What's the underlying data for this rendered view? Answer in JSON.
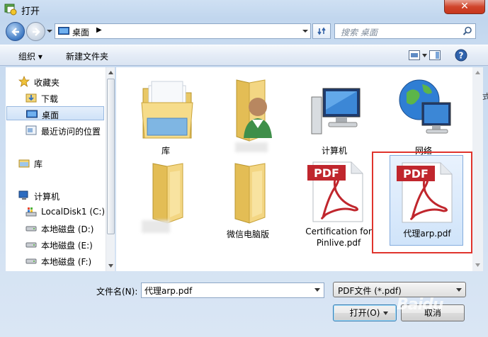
{
  "window": {
    "title": "打开",
    "close_glyph": "✕"
  },
  "address": {
    "path": "桌面",
    "separator": "▶"
  },
  "search": {
    "placeholder": "搜索 桌面"
  },
  "toolbar": {
    "organize": "组织 ▾",
    "new_folder": "新建文件夹"
  },
  "nav": {
    "favorites": "收藏夹",
    "downloads": "下载",
    "desktop": "桌面",
    "recent": "最近访问的位置",
    "libraries": "库",
    "computer": "计算机",
    "drive_c": "LocalDisk1 (C:)",
    "drive_d": "本地磁盘 (D:)",
    "drive_e": "本地磁盘 (E:)",
    "drive_f": "本地磁盘 (F:)"
  },
  "files": {
    "libraries": "库",
    "user_folder": "",
    "computer": "计算机",
    "network": "网络",
    "folder2": "",
    "wechat_folder": "微信电脑版",
    "certification": "Certification for Pinlive.pdf",
    "selected_pdf": "代理arp.pdf",
    "pdf_badge": "PDF"
  },
  "bottom": {
    "filename_label": "文件名(N):",
    "filename_value": "代理arp.pdf",
    "filetype": "PDF文件 (*.pdf)",
    "open_button": "打开(O)",
    "cancel_button": "取消"
  },
  "watermark": "Baidu",
  "edge_text": "式",
  "colors": {
    "highlight_red": "#e0342d",
    "selection_blue": "#cfe2f8",
    "pdf_red": "#c0262d"
  }
}
